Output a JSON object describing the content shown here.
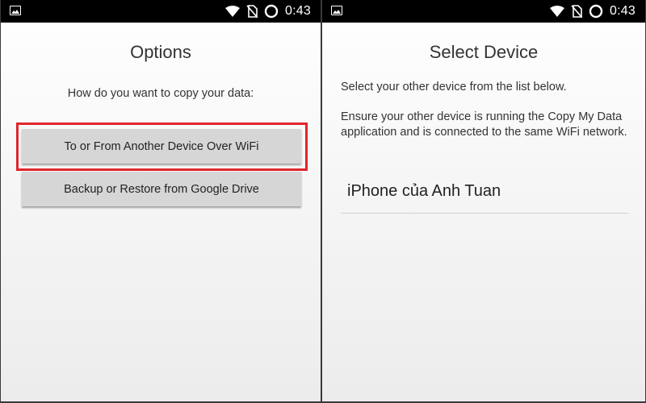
{
  "status_bar": {
    "time": "0:43",
    "icons": [
      "image-icon",
      "wifi-icon",
      "no-sim-icon",
      "sync-icon"
    ]
  },
  "options_screen": {
    "title": "Options",
    "prompt": "How do you want to copy your data:",
    "buttons": [
      {
        "label": "To or From Another Device Over WiFi",
        "highlighted": true
      },
      {
        "label": "Backup or Restore from Google Drive",
        "highlighted": false
      }
    ],
    "highlight_color": "#e0262b"
  },
  "select_device_screen": {
    "title": "Select Device",
    "instruction1": "Select your other device from the list below.",
    "instruction2": "Ensure your other device is running the Copy My Data application and is connected to the same WiFi network.",
    "devices": [
      "iPhone của Anh Tuan"
    ]
  }
}
